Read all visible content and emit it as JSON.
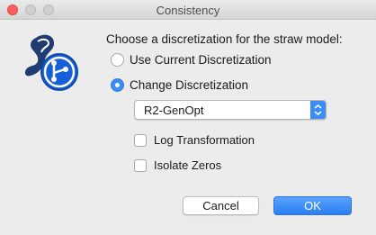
{
  "window": {
    "title": "Consistency"
  },
  "dialog": {
    "prompt": "Choose a discretization for the straw model:",
    "options": [
      {
        "label": "Use Current Discretization",
        "selected": false
      },
      {
        "label": "Change Discretization",
        "selected": true
      }
    ],
    "discretization_select": {
      "value": "R2-GenOpt"
    },
    "checkboxes": [
      {
        "label": "Log Transformation",
        "checked": false
      },
      {
        "label": "Isolate Zeros",
        "checked": false
      }
    ],
    "buttons": {
      "cancel": "Cancel",
      "ok": "OK"
    }
  },
  "colors": {
    "accent": "#3b8cf5",
    "close_button": "#fc605c"
  },
  "icons": {
    "app": "app-logo-icon",
    "select_arrows": "up-down-chevron-icon"
  }
}
